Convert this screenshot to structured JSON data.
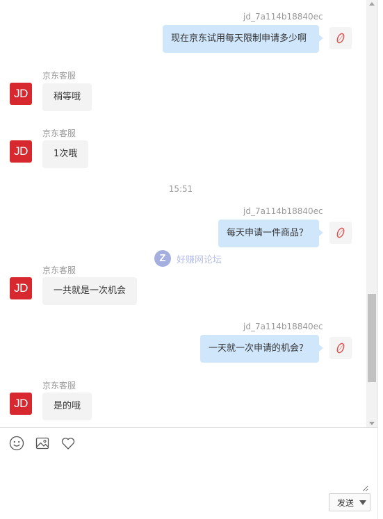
{
  "conversation": {
    "user_name": "jd_7a114b18840ec",
    "agent_name": "京东客服",
    "agent_avatar_text": "JD",
    "timestamp": "15:51",
    "messages": [
      {
        "from": "user",
        "sender": "jd_7a114b18840ec",
        "text": "现在京东试用每天限制申请多少啊"
      },
      {
        "from": "agent",
        "sender": "京东客服",
        "text": "稍等哦"
      },
      {
        "from": "agent",
        "sender": "京东客服",
        "text": "1次哦"
      },
      {
        "from": "user",
        "sender": "jd_7a114b18840ec",
        "text": "每天申请一件商品？"
      },
      {
        "from": "agent",
        "sender": "京东客服",
        "text": "一共就是一次机会"
      },
      {
        "from": "user",
        "sender": "jd_7a114b18840ec",
        "text": "一天就一次申请的机会？"
      },
      {
        "from": "agent",
        "sender": "京东客服",
        "text": "是的哦"
      }
    ]
  },
  "watermark": {
    "logo": "Z",
    "text": "好赚网论坛"
  },
  "toolbar": {
    "icons": [
      "emoji-icon",
      "image-icon",
      "heart-icon"
    ]
  },
  "compose": {
    "input_value": "",
    "send_label": "发送"
  },
  "colors": {
    "user_bubble": "#cfe6fb",
    "agent_bubble": "#f3f3f3",
    "jd_red": "#d7282f"
  }
}
